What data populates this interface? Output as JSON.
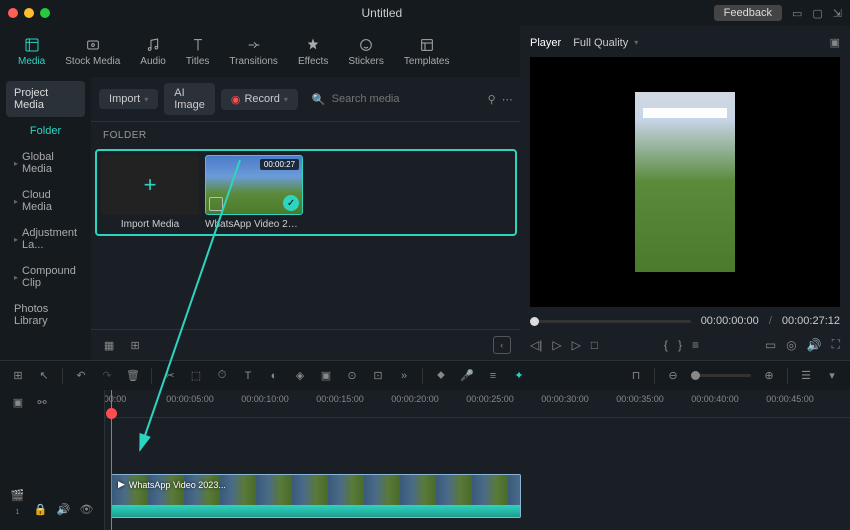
{
  "titlebar": {
    "title": "Untitled",
    "feedback": "Feedback"
  },
  "tabs": [
    {
      "label": "Media"
    },
    {
      "label": "Stock Media"
    },
    {
      "label": "Audio"
    },
    {
      "label": "Titles"
    },
    {
      "label": "Transitions"
    },
    {
      "label": "Effects"
    },
    {
      "label": "Stickers"
    },
    {
      "label": "Templates"
    }
  ],
  "sidebar": [
    {
      "label": "Project Media"
    },
    {
      "label": "Folder"
    },
    {
      "label": "Global Media"
    },
    {
      "label": "Cloud Media"
    },
    {
      "label": "Adjustment La..."
    },
    {
      "label": "Compound Clip"
    },
    {
      "label": "Photos Library"
    }
  ],
  "toolbar": {
    "import": "Import",
    "ai_image": "AI Image",
    "record": "Record",
    "search_placeholder": "Search media"
  },
  "folder_header": "FOLDER",
  "media": {
    "import_label": "Import Media",
    "clip_label": "WhatsApp Video 202...",
    "duration": "00:00:27"
  },
  "player": {
    "tab": "Player",
    "quality": "Full Quality",
    "current": "00:00:00:00",
    "total": "00:00:27:12"
  },
  "timeline": {
    "marks": [
      "00:00",
      "00:00:05:00",
      "00:00:10:00",
      "00:00:15:00",
      "00:00:20:00",
      "00:00:25:00",
      "00:00:30:00",
      "00:00:35:00",
      "00:00:40:00",
      "00:00:45:00"
    ],
    "clip_label": "WhatsApp Video 2023..."
  }
}
